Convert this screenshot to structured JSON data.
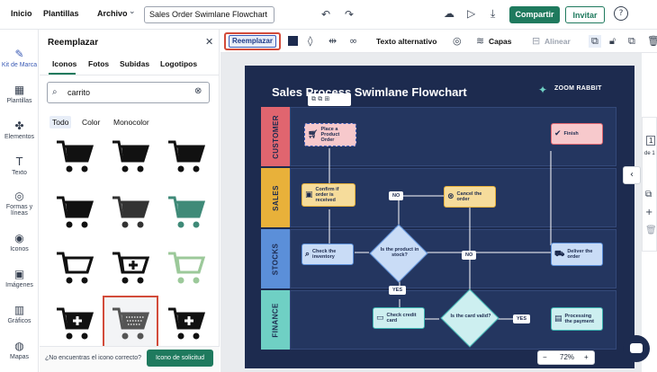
{
  "topbar": {
    "home": "Inicio",
    "templates": "Plantillas",
    "file": "Archivo",
    "doc_title": "Sales Order Swimlane Flowchart",
    "share": "Compartir",
    "invite": "Invitar"
  },
  "rail": [
    {
      "label": "Kit de Marca",
      "icon": "brand-kit-icon",
      "glyph": "✎"
    },
    {
      "label": "Plantillas",
      "icon": "templates-icon",
      "glyph": "▦"
    },
    {
      "label": "Elementos",
      "icon": "elements-icon",
      "glyph": "✤"
    },
    {
      "label": "Texto",
      "icon": "text-icon",
      "glyph": "T"
    },
    {
      "label": "Formas y líneas",
      "icon": "shapes-icon",
      "glyph": "◎"
    },
    {
      "label": "Iconos",
      "icon": "icons-icon",
      "glyph": "◉"
    },
    {
      "label": "Imágenes",
      "icon": "images-icon",
      "glyph": "▣"
    },
    {
      "label": "Gráficos",
      "icon": "charts-icon",
      "glyph": "▥"
    },
    {
      "label": "Mapas",
      "icon": "maps-icon",
      "glyph": "◍"
    }
  ],
  "panel": {
    "title": "Reemplazar",
    "tabs": [
      "Iconos",
      "Fotos",
      "Subidas",
      "Logotipos"
    ],
    "search_value": "carrito",
    "filters": [
      "Todo",
      "Color",
      "Monocolor"
    ],
    "footer_text": "¿No encuentras el icono correcto?",
    "footer_button": "Icono de solicitud"
  },
  "toolbar": {
    "replace": "Reemplazar",
    "alt_text": "Texto alternativo",
    "layers": "Capas",
    "align": "Alinear"
  },
  "board": {
    "title": "Sales Process Swimlane Flowchart",
    "logo": "ZOOM RABBIT",
    "lanes": [
      "CUSTOMER",
      "SALES",
      "STOCKS",
      "FINANCE"
    ],
    "lane_colors": [
      "#e0656f",
      "#e8b13a",
      "#5b8fd9",
      "#6fd0c4"
    ],
    "nodes": {
      "place": "Place a Product Order",
      "finish": "Finish",
      "confirm": "Confirm if order is received",
      "cancel": "Cancel the order",
      "check_inv": "Check the inventory",
      "in_stock": "Is the product in stock?",
      "deliver": "Deliver the order",
      "check_card": "Check credit card",
      "card_valid": "Is the card valid?",
      "processing": "Processing the payment"
    },
    "labels": {
      "no1": "NO",
      "no2": "NO",
      "yes1": "YES",
      "yes2": "YES"
    }
  },
  "zoom": {
    "minus": "−",
    "value": "72%",
    "plus": "+"
  },
  "right_panel": {
    "page": "1",
    "of": "de 1"
  }
}
